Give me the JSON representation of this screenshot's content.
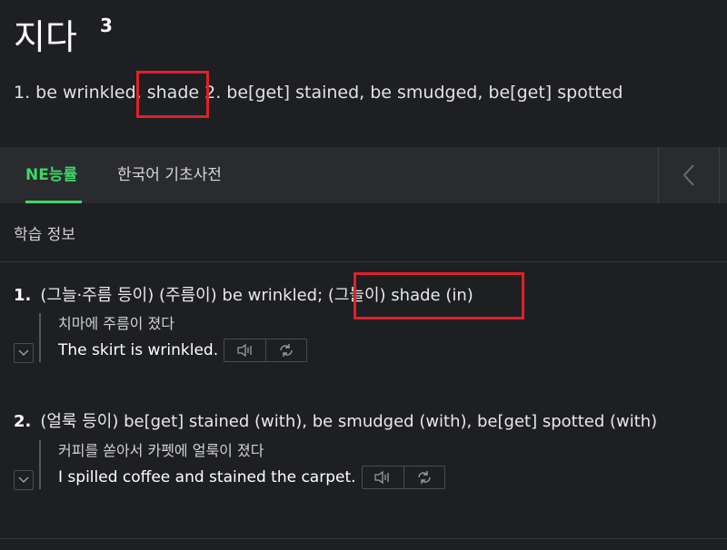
{
  "entry": {
    "headword": "지다",
    "superscript": "3",
    "summary": "1. be wrinkled, shade 2. be[get] stained, be smudged, be[get] spotted"
  },
  "tabs": [
    {
      "label": "NE능률",
      "active": true
    },
    {
      "label": "한국어 기초사전",
      "active": false
    }
  ],
  "section": {
    "study_info": "학습 정보"
  },
  "senses": [
    {
      "number": "1.",
      "text": "(그늘·주름 등이) (주름이) be wrinkled; (그늘이) shade (in)",
      "example_ko": "치마에 주름이 졌다",
      "example_en": "The skirt is wrinkled."
    },
    {
      "number": "2.",
      "text": "(얼룩 등이) be[get] stained (with), be smudged (with), be[get] spotted (with)",
      "example_ko": "커피를 쏟아서 카펫에 얼룩이 졌다",
      "example_en": "I spilled coffee and stained the carpet."
    }
  ],
  "colors": {
    "background": "#1e1f22",
    "tabbar": "#2a2b2f",
    "accent_green": "#3fd46a",
    "highlight_red": "#e0202a"
  },
  "icons": [
    "chevron-left-icon",
    "speaker-icon",
    "repeat-icon",
    "chevron-down-icon"
  ]
}
